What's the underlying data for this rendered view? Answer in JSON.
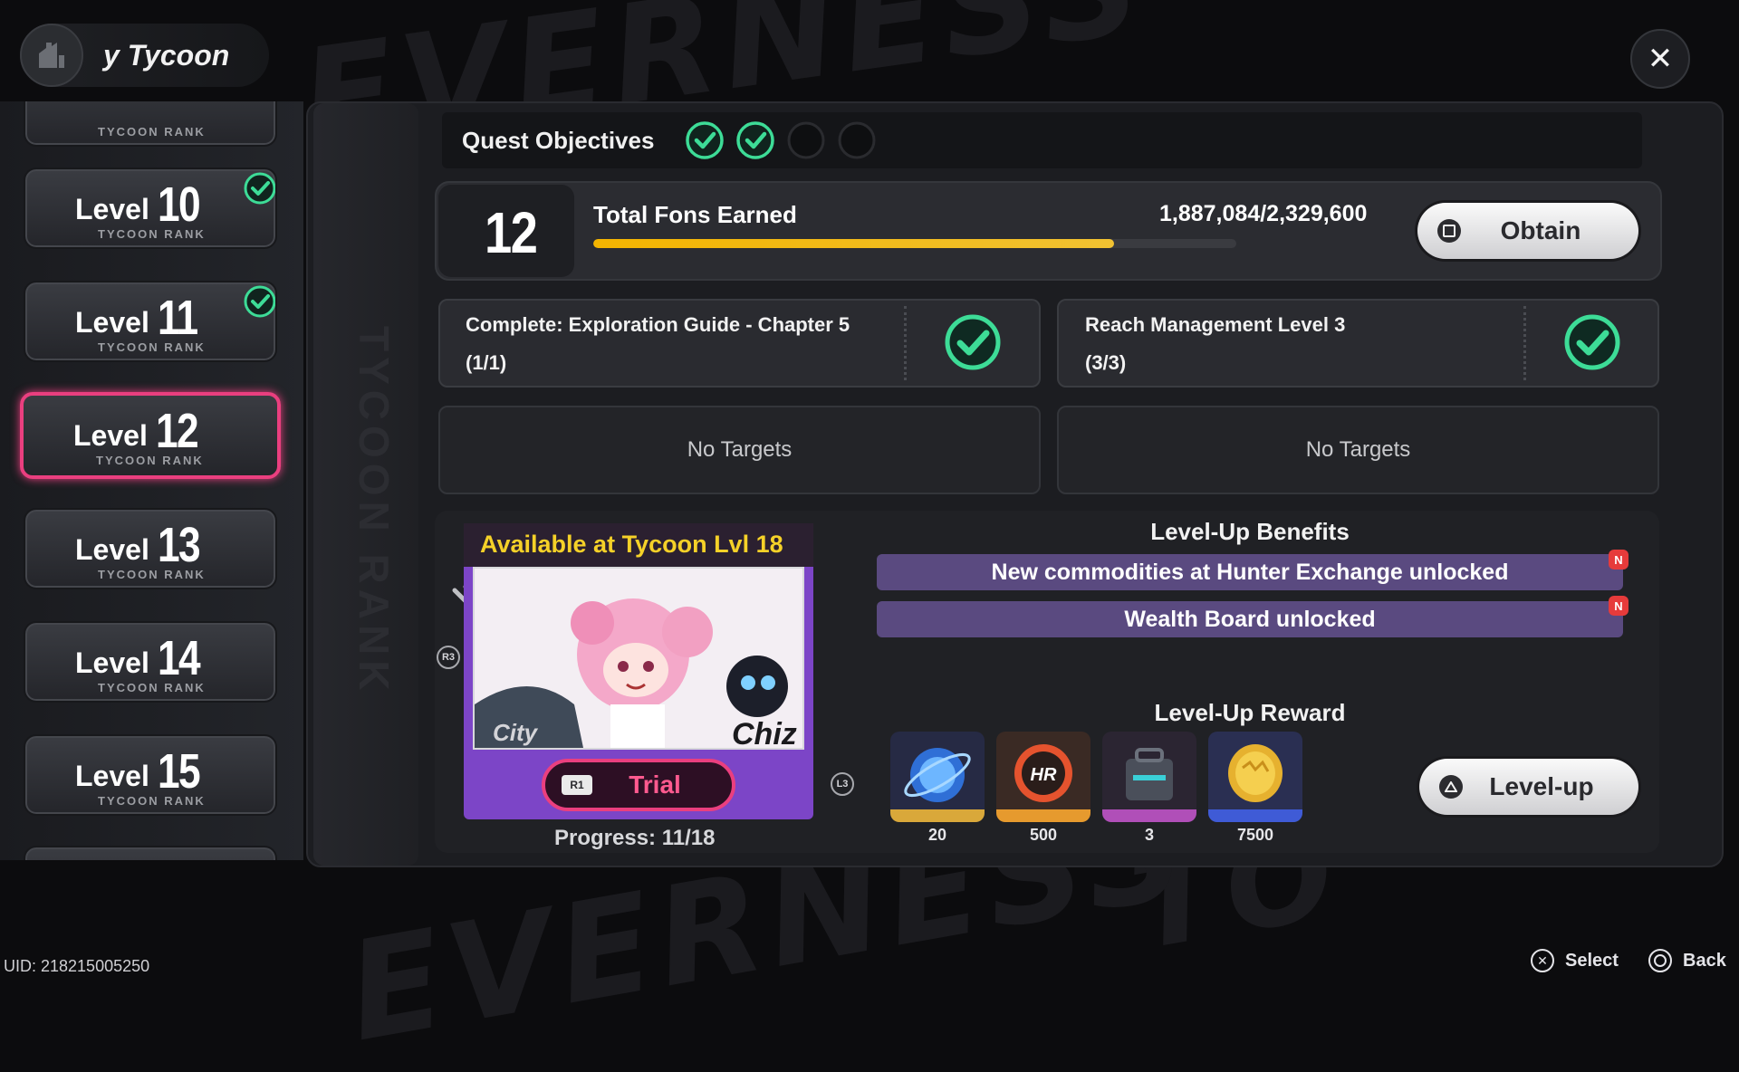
{
  "background": {
    "watermark_words": [
      "EVERNESS",
      "TO",
      "EVERNESS"
    ]
  },
  "header": {
    "title": "y Tycoon"
  },
  "sidebar": {
    "partial_top_sub": "TYCOON RANK",
    "items": [
      {
        "word": "Level",
        "number": "10",
        "sub": "TYCOON RANK",
        "completed": true,
        "selected": false
      },
      {
        "word": "Level",
        "number": "11",
        "sub": "TYCOON RANK",
        "completed": true,
        "selected": false
      },
      {
        "word": "Level",
        "number": "12",
        "sub": "TYCOON RANK",
        "completed": false,
        "selected": true
      },
      {
        "word": "Level",
        "number": "13",
        "sub": "TYCOON RANK",
        "completed": false,
        "selected": false
      },
      {
        "word": "Level",
        "number": "14",
        "sub": "TYCOON RANK",
        "completed": false,
        "selected": false
      },
      {
        "word": "Level",
        "number": "15",
        "sub": "TYCOON RANK",
        "completed": false,
        "selected": false
      }
    ]
  },
  "spine_label": "TYCOON RANK",
  "objectives": {
    "label": "Quest Objectives",
    "states": [
      "done",
      "done",
      "pending",
      "pending"
    ]
  },
  "fons": {
    "level": "12",
    "label": "Total Fons Earned",
    "value": "1,887,084/2,329,600",
    "progress": 0.81,
    "obtain_label": "Obtain"
  },
  "tasks": [
    {
      "line1": "Complete: Exploration Guide - Chapter 5",
      "line2": "(1/1)",
      "done": true
    },
    {
      "line1": "Reach Management Level 3",
      "line2": "(3/3)",
      "done": true
    }
  ],
  "empty_slots": [
    "No Targets",
    "No Targets"
  ],
  "trial": {
    "header": "Available at Tycoon Lvl 18",
    "character": "Chiz",
    "button_key": "R1",
    "button_label": "Trial",
    "progress": "Progress: 11/18",
    "left_glyph": "R3",
    "right_glyph": "L3"
  },
  "benefits": {
    "title": "Level-Up Benefits",
    "items": [
      {
        "text": "New commodities at Hunter Exchange unlocked",
        "badge": "N"
      },
      {
        "text": "Wealth Board unlocked",
        "badge": "N"
      }
    ]
  },
  "rewards": {
    "title": "Level-Up Reward",
    "items": [
      {
        "icon": "blue-crystal-icon",
        "count": "20",
        "color": "#d9a83a"
      },
      {
        "icon": "hunter-badge-icon",
        "count": "500",
        "color": "#e69a2e"
      },
      {
        "icon": "toolbox-icon",
        "count": "3",
        "color": "#b04fb8"
      },
      {
        "icon": "gold-coin-icon",
        "count": "7500",
        "color": "#3f5bd6"
      }
    ]
  },
  "levelup_label": "Level-up",
  "uid": "UID: 218215005250",
  "footer": {
    "select_label": "Select",
    "back_label": "Back"
  },
  "colors": {
    "accent_pink": "#ea3f7f",
    "check_green": "#3ddc97",
    "gold": "#f5d128",
    "benefit_purple": "#5a4a80"
  }
}
